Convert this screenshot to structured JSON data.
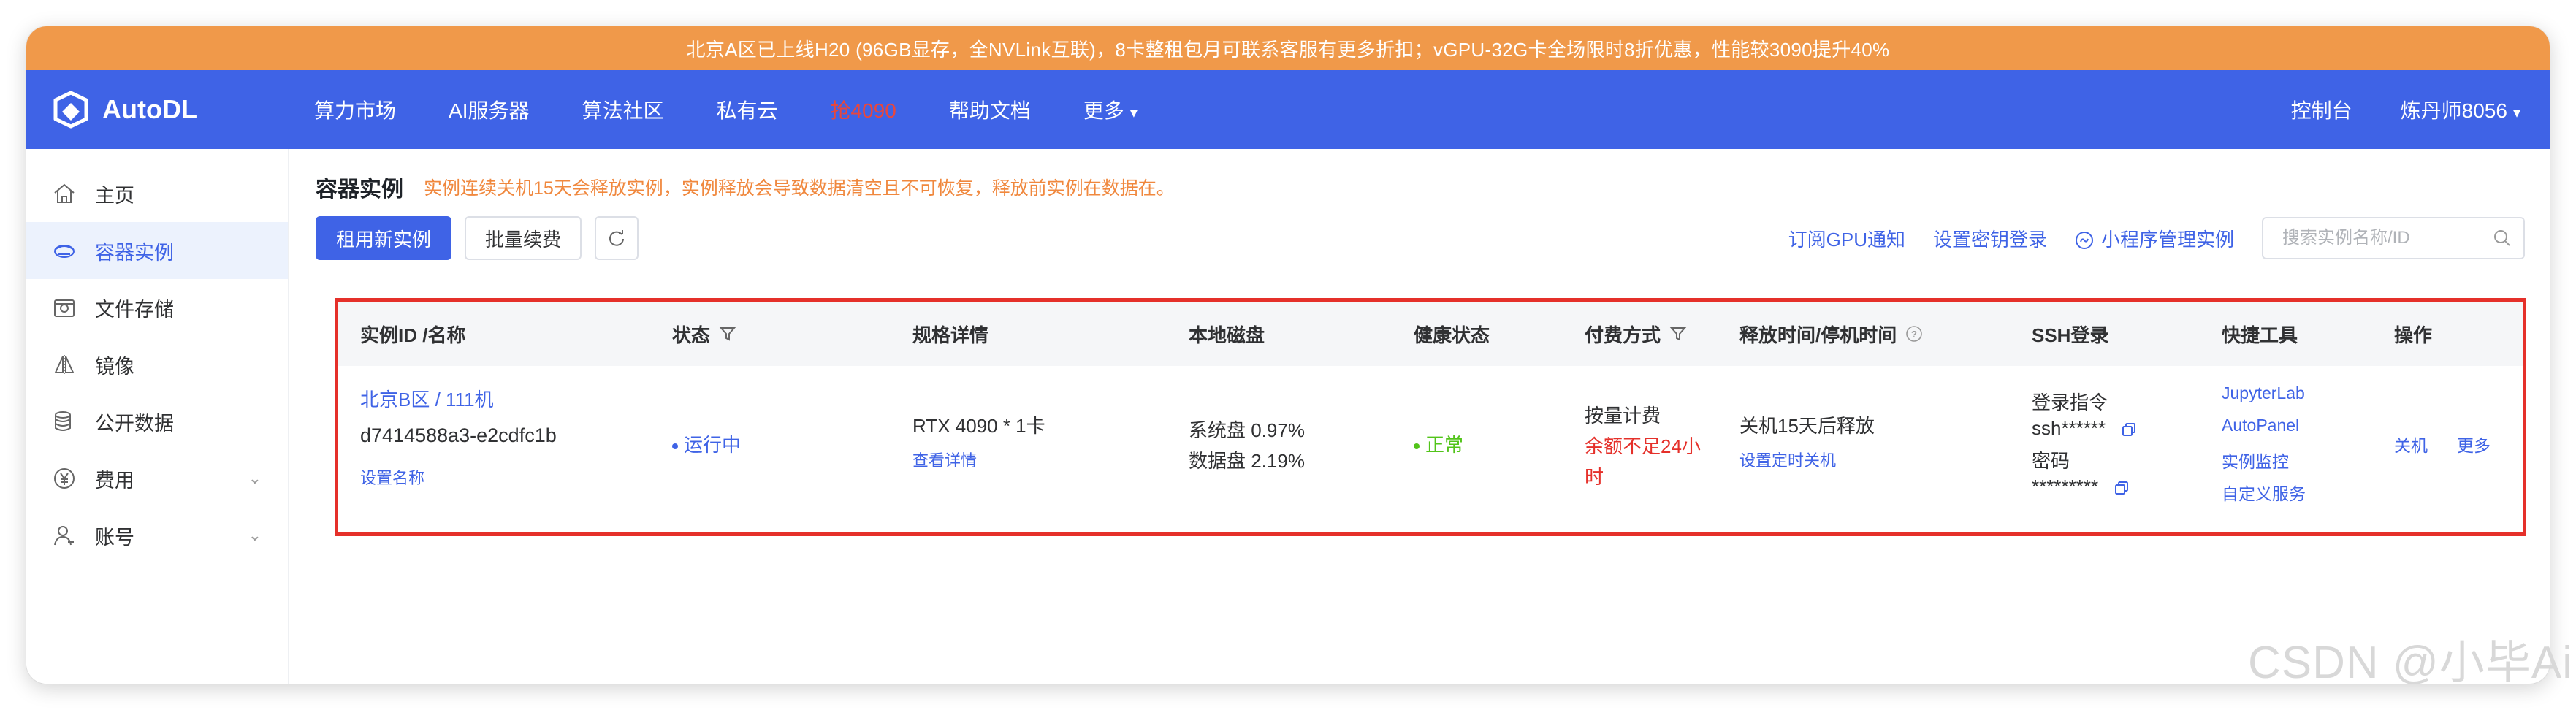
{
  "banner": {
    "text": "北京A区已上线H20 (96GB显存，全NVLink互联)，8卡整租包月可联系客服有更多折扣；vGPU-32G卡全场限时8折优惠，性能较3090提升40%"
  },
  "topnav": {
    "brand": "AutoDL",
    "items": [
      "算力市场",
      "AI服务器",
      "算法社区",
      "私有云",
      "抢4090",
      "帮助文档",
      "更多"
    ],
    "console": "控制台",
    "user": "炼丹师8056"
  },
  "sidebar": {
    "items": [
      {
        "label": "主页",
        "icon": "home-icon"
      },
      {
        "label": "容器实例",
        "icon": "container-icon"
      },
      {
        "label": "文件存储",
        "icon": "storage-icon"
      },
      {
        "label": "镜像",
        "icon": "image-icon"
      },
      {
        "label": "公开数据",
        "icon": "database-icon"
      },
      {
        "label": "费用",
        "icon": "yen-icon"
      },
      {
        "label": "账号",
        "icon": "user-icon"
      }
    ]
  },
  "main": {
    "title": "容器实例",
    "warning": "实例连续关机15天会释放实例，实例释放会导致数据清空且不可恢复，释放前实例在数据在。",
    "toolbar": {
      "rent": "租用新实例",
      "renew": "批量续费",
      "refresh_icon": "refresh-icon",
      "subscribe": "订阅GPU通知",
      "ssh_key": "设置密钥登录",
      "miniprogram": "小程序管理实例",
      "search_placeholder": "搜索实例名称/ID"
    },
    "table": {
      "headers": [
        "实例ID /名称",
        "状态",
        "规格详情",
        "本地磁盘",
        "健康状态",
        "付费方式",
        "释放时间/停机时间",
        "SSH登录",
        "快捷工具",
        "操作"
      ],
      "row": {
        "region": "北京B区 / 111机",
        "instance_id": "d7414588a3-e2cdfc1b",
        "set_name": "设置名称",
        "status": "运行中",
        "spec": "RTX 4090 * 1卡",
        "spec_link": "查看详情",
        "system_disk": "系统盘 0.97%",
        "data_disk": "数据盘 2.19%",
        "health": "正常",
        "billing": "按量计费",
        "balance_line1": "余额不足24小",
        "balance_line2": "时",
        "release": "关机15天后释放",
        "schedule": "设置定时关机",
        "ssh_cmd_label": "登录指令",
        "ssh_cmd": "ssh******",
        "pwd_label": "密码",
        "pwd": "*********",
        "tools": [
          "JupyterLab",
          "AutoPanel",
          "实例监控",
          "自定义服务"
        ],
        "actions": [
          "关机",
          "更多"
        ]
      }
    }
  },
  "watermark": "CSDN @小毕Ai",
  "colors": {
    "primary": "#3f63e6",
    "banner": "#f0994a",
    "warning": "#f0883e",
    "danger": "#e5302a",
    "success": "#52c41a"
  }
}
